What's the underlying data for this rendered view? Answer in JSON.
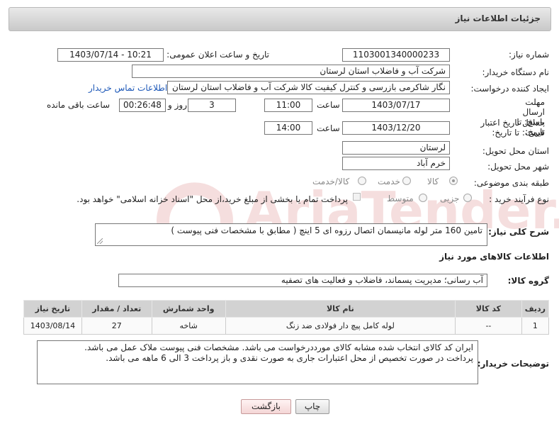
{
  "header": {
    "title": "جزئیات اطلاعات نیاز"
  },
  "form": {
    "need_number_label": "شماره نیاز:",
    "need_number": "1103001340000233",
    "announce_label": "تاریخ و ساعت اعلان عمومی:",
    "announce_value": "1403/07/14 - 10:21",
    "buyer_org_label": "نام دستگاه خریدار:",
    "buyer_org": "شرکت آب و فاضلاب استان لرستان",
    "creator_label": "ایجاد کننده درخواست:",
    "creator": "نگار شاکرمی بازرسی و کنترل کیفیت کالا شرکت آب و فاضلاب استان لرستان",
    "contact_link": "اطلاعات تماس خریدار",
    "reply_deadline_label": "مهلت ارسال پاسخ: تا تاریخ:",
    "reply_date": "1403/07/17",
    "time_label": "ساعت",
    "reply_time": "11:00",
    "days_value": "3",
    "days_label": "روز و",
    "remaining_time": "00:26:48",
    "remaining_label": "ساعت باقی مانده",
    "price_validity_label": "حداقل تاریخ اعتبار قیمت: تا تاریخ:",
    "price_date": "1403/12/20",
    "price_time": "14:00",
    "province_label": "استان محل تحویل:",
    "province": "لرستان",
    "city_label": "شهر محل تحویل:",
    "city": "خرم آباد",
    "category_label": "طبقه بندی موضوعی:",
    "category_options": [
      "کالا",
      "خدمت",
      "کالا/خدمت"
    ],
    "category_selected": "کالا",
    "process_label": "نوع فرآیند خرید :",
    "process_options": [
      "جزیی",
      "متوسط"
    ],
    "payment_note": "پرداخت تمام یا بخشی از مبلغ خرید،از محل \"اسناد خزانه اسلامی\" خواهد بود."
  },
  "description": {
    "label": "شرح کلی نیاز:",
    "value": "تامین 160 متر لوله مانیسمان اتصال رزوه ای 5 اینچ ( مطابق با مشخصات فنی پیوست )"
  },
  "goods_section": {
    "title": "اطلاعات کالاهای مورد نیاز",
    "group_label": "گروه کالا:",
    "group_value": "آب رسانی؛ مدیریت پسماند، فاضلاب و فعالیت های تصفیه"
  },
  "table": {
    "headers": [
      "ردیف",
      "کد کالا",
      "نام کالا",
      "واحد شمارش",
      "تعداد / مقدار",
      "تاریخ نیاز"
    ],
    "rows": [
      [
        "1",
        "--",
        "لوله کامل پیچ دار فولادی ضد زنگ",
        "شاخه",
        "27",
        "1403/08/14"
      ]
    ]
  },
  "buyer_notes": {
    "label": "توضیحات خریدار:",
    "line1": "ایران کد کالای انتخاب شده مشابه کالای مورددرخواست می باشد. مشخصات فنی پیوست ملاک عمل می باشد.",
    "line2": "پرداخت در صورت تخصیص از محل اعتبارات جاری  به صورت نقدی و باز پرداخت  3 الی 6 ماهه می باشد."
  },
  "buttons": {
    "print": "چاپ",
    "back": "بازگشت"
  },
  "watermark": {
    "text": "AriaTender.net"
  },
  "colors": {
    "link": "#1d58b8",
    "header_bg": "#d4d4d4",
    "table_header": "#d2d2d2",
    "back_button": "#f4d6d6"
  }
}
